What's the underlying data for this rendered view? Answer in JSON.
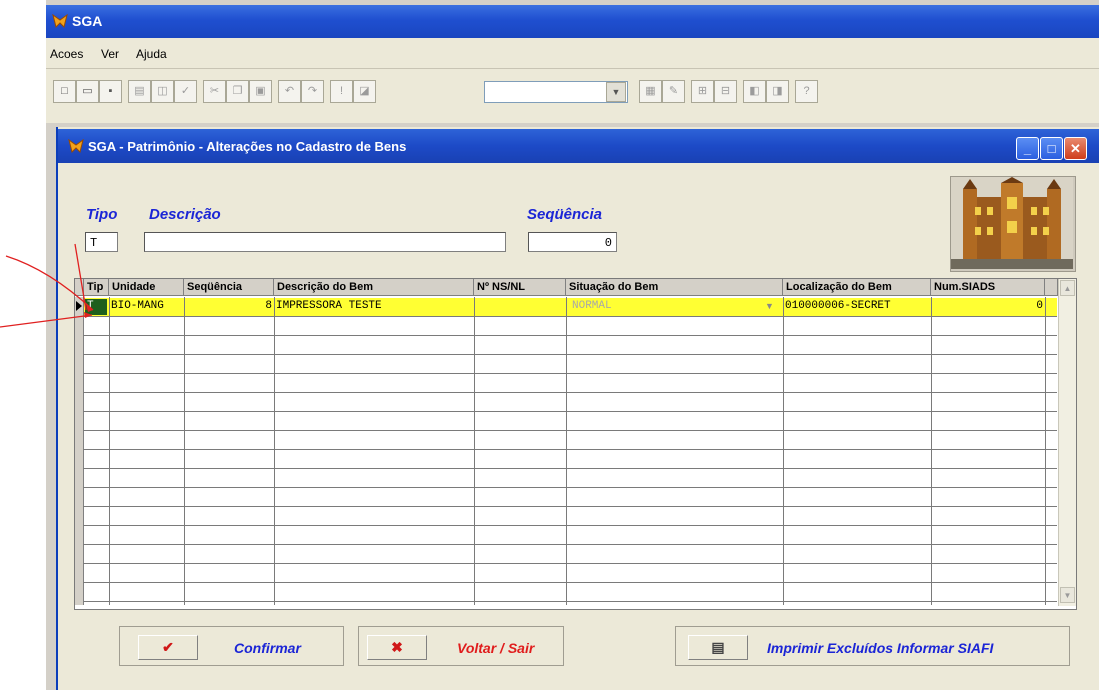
{
  "app": {
    "title": "SGA",
    "menu": [
      "Acoes",
      "Ver",
      "Ajuda"
    ]
  },
  "window": {
    "title": "SGA - Patrimônio - Alterações no Cadastro de Bens"
  },
  "form": {
    "tipo_label": "Tipo",
    "tipo_value": "T",
    "descricao_label": "Descrição",
    "descricao_value": "",
    "sequencia_label": "Seqüência",
    "sequencia_value": "0"
  },
  "grid": {
    "columns": [
      "Tip",
      "Unidade",
      "Seqüência",
      "Descrição do Bem",
      "Nº NS/NL",
      "Situação do Bem",
      "Localização do Bem",
      "Num.SIADS"
    ],
    "rows": [
      {
        "tip": "T",
        "unidade": "BIO-MANG",
        "sequencia": "8",
        "descricao": "IMPRESSORA TESTE",
        "ns_nl": "",
        "situacao": "NORMAL",
        "localizacao": "010000006-SECRET",
        "num_siads": "0"
      }
    ]
  },
  "buttons": {
    "confirmar": "Confirmar",
    "voltar": "Voltar / Sair",
    "imprimir": "Imprimir Excluídos Informar SIAFI"
  },
  "colors": {
    "titlebar": "#1f4fd0",
    "label_blue": "#1b25d6",
    "row_highlight": "#ffff33",
    "cancel_red": "#e01c1c",
    "annotation": "#e02020"
  }
}
